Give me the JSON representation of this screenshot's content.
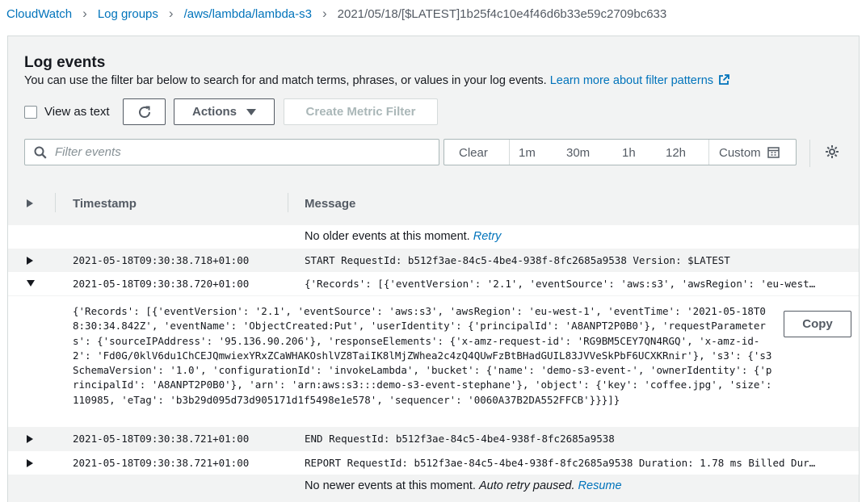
{
  "breadcrumb": {
    "items": [
      "CloudWatch",
      "Log groups",
      "/aws/lambda/lambda-s3"
    ],
    "current": "2021/05/18/[$LATEST]1b25f4c10e4f46d6b33e59c2709bc633"
  },
  "panel": {
    "title": "Log events",
    "description": "You can use the filter bar below to search for and match terms, phrases, or values in your log events.",
    "learn_more": "Learn more about filter patterns"
  },
  "toolbar": {
    "view_as_text": "View as text",
    "view_as_text_checked": false,
    "actions_label": "Actions",
    "create_metric_filter": "Create Metric Filter"
  },
  "filter": {
    "placeholder": "Filter events",
    "time_range": [
      "Clear",
      "1m",
      "30m",
      "1h",
      "12h",
      "Custom"
    ]
  },
  "table": {
    "headers": {
      "timestamp": "Timestamp",
      "message": "Message"
    },
    "no_older": "No older events at this moment.",
    "retry": "Retry",
    "no_newer": "No newer events at this moment.",
    "auto_retry": "Auto retry paused.",
    "resume": "Resume",
    "rows": [
      {
        "timestamp": "2021-05-18T09:30:38.718+01:00",
        "message": "START RequestId: b512f3ae-84c5-4be4-938f-8fc2685a9538 Version: $LATEST",
        "expanded": false
      },
      {
        "timestamp": "2021-05-18T09:30:38.720+01:00",
        "message": "{'Records': [{'eventVersion': '2.1', 'eventSource': 'aws:s3', 'awsRegion': 'eu-west…",
        "expanded": true
      },
      {
        "timestamp": "2021-05-18T09:30:38.721+01:00",
        "message": "END RequestId: b512f3ae-84c5-4be4-938f-8fc2685a9538",
        "expanded": false
      },
      {
        "timestamp": "2021-05-18T09:30:38.721+01:00",
        "message": "REPORT RequestId: b512f3ae-84c5-4be4-938f-8fc2685a9538 Duration: 1.78 ms Billed Dur…",
        "expanded": false
      }
    ],
    "expanded_message": "{'Records': [{'eventVersion': '2.1', 'eventSource': 'aws:s3', 'awsRegion': 'eu-west-1', 'eventTime': '2021-05-18T08:30:34.842Z', 'eventName': 'ObjectCreated:Put', 'userIdentity': {'principalId': 'A8ANPT2P0B0'}, 'requestParameters': {'sourceIPAddress': '95.136.90.206'}, 'responseElements': {'x-amz-request-id': 'RG9BM5CEY7QN4RGQ', 'x-amz-id-2': 'Fd0G/0klV6du1ChCEJQmwiexYRxZCaWHAKOshlVZ8TaiIK8lMjZWhea2c4zQ4QUwFzBtBHadGUIL83JVVeSkPbF6UCXKRnir'}, 's3': {'s3SchemaVersion': '1.0', 'configurationId': 'invokeLambda', 'bucket': {'name': 'demo-s3-event-', 'ownerIdentity': {'principalId': 'A8ANPT2P0B0'}, 'arn': 'arn:aws:s3:::demo-s3-event-stephane'}, 'object': {'key': 'coffee.jpg', 'size': 110985, 'eTag': 'b3b29d095d73d905171d1f5498e1e578', 'sequencer': '0060A37B2DA552FFCB'}}}]}",
    "copy_label": "Copy"
  },
  "colors": {
    "link": "#0073bb",
    "panel_bg": "#f2f3f3",
    "text": "#16191f",
    "muted": "#545b64"
  }
}
